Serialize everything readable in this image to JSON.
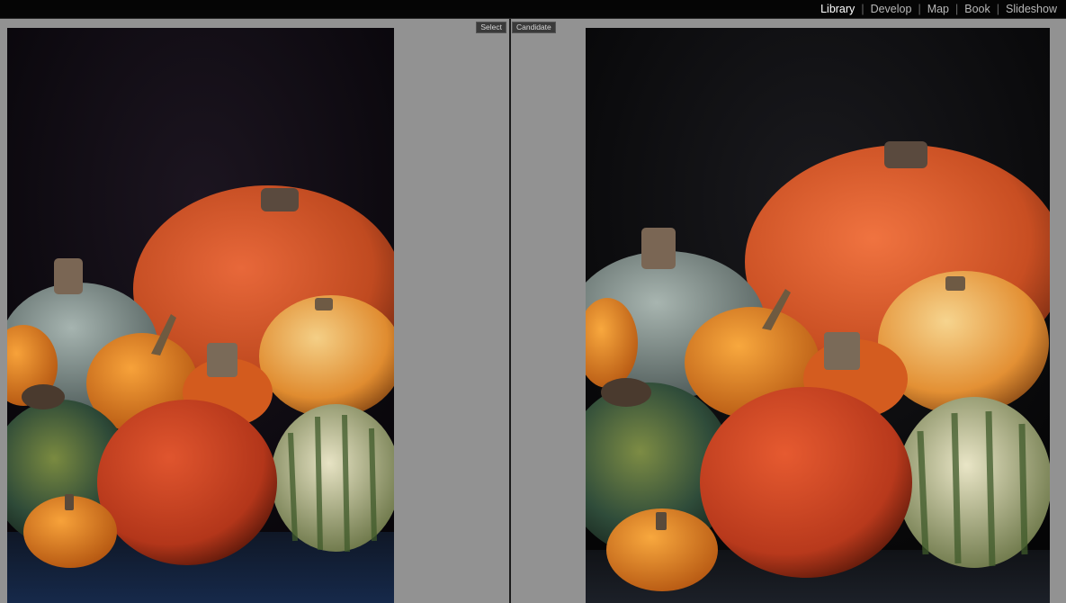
{
  "modules": {
    "items": [
      {
        "label": "Library",
        "active": true
      },
      {
        "label": "Develop",
        "active": false
      },
      {
        "label": "Map",
        "active": false
      },
      {
        "label": "Book",
        "active": false
      },
      {
        "label": "Slideshow",
        "active": false
      }
    ]
  },
  "compare": {
    "select_label": "Select",
    "candidate_label": "Candidate"
  },
  "colors": {
    "accent_active": "#ffffff",
    "module_inactive": "#b8b8b8",
    "background": "#8f8f8f"
  }
}
